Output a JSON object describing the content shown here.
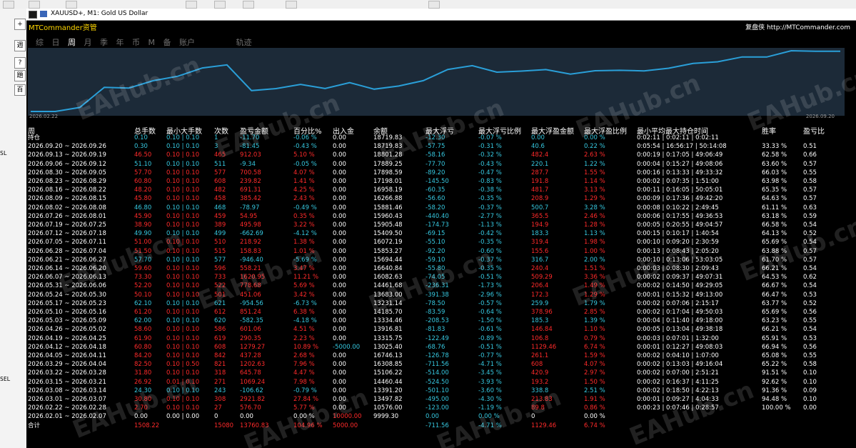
{
  "window": {
    "title": "XAUUSD+, M1:  Gold US Dollar"
  },
  "left_panel": {
    "buttons": [
      "+",
      "週",
      "?",
      "題",
      "百"
    ],
    "labels": [
      "SL",
      "SEL"
    ]
  },
  "header": {
    "brand": "MTCommander资管",
    "copyright": "复盘侠 http://MTCommander.com",
    "tabs": [
      "综",
      "日",
      "周",
      "月",
      "季",
      "年",
      "币",
      "M",
      "备",
      "账户"
    ],
    "active_tab": "周",
    "track_tab": "轨迹"
  },
  "plot": {
    "start_date": "2026.02.22",
    "end_date": "2026.09.20"
  },
  "watermark": "EAHub.cn",
  "colors": {
    "background": "#000000",
    "line": "#2a9fd8",
    "positive": "#ff2a2a",
    "negative": "#36c8e0",
    "neutral": "#ffffff"
  },
  "table": {
    "columns": [
      "周",
      "总手数",
      "最小大手数",
      "次数",
      "盈亏金额",
      "百分比%",
      "出入金",
      "余额",
      "最大浮亏",
      "最大浮亏比例",
      "最大浮盈金额",
      "最大浮盈比例",
      "最小平均最大持仓时间",
      "胜率",
      "盈亏比"
    ],
    "rows": [
      [
        "持仓",
        "0.10",
        "0.10 | 0.10",
        "1",
        "-11.70",
        "-0.06 %",
        "0.00",
        "18719.83",
        "-12.30",
        "-0.07 %",
        "0.00",
        "0.00 %",
        "0:02:11 | 0:02:11 | 0:02:11",
        "",
        ""
      ],
      [
        "2026.09.20 ~ 2026.09.26",
        "0.30",
        "0.10 | 0.10",
        "3",
        "-81.45",
        "-0.43 %",
        "0.00",
        "18719.83",
        "-57.75",
        "-0.31 %",
        "40.6",
        "0.22 %",
        "0:05:54 | 16:56:17 | 50:14:08",
        "33.33 %",
        "0.51"
      ],
      [
        "2026.09.13 ~ 2026.09.19",
        "46.50",
        "0.10 | 0.10",
        "465",
        "912.03",
        "5.10 %",
        "0.00",
        "18801.28",
        "-58.16",
        "-0.32 %",
        "482.4",
        "2.63 %",
        "0:00:19 | 0:17:05 | 49:06:49",
        "62.58 %",
        "0.66"
      ],
      [
        "2026.09.06 ~ 2026.09.12",
        "51.10",
        "0.10 | 0.10",
        "511",
        "-9.34",
        "-0.05 %",
        "0.00",
        "17889.25",
        "-77.70",
        "-0.43 %",
        "220.1",
        "1.22 %",
        "0:00:04 | 0:15:27 | 49:08:06",
        "63.60 %",
        "0.57"
      ],
      [
        "2026.08.30 ~ 2026.09.05",
        "57.70",
        "0.10 | 0.10",
        "577",
        "700.58",
        "4.07 %",
        "0.00",
        "17898.59",
        "-89.20",
        "-0.47 %",
        "287.7",
        "1.55 %",
        "0:00:16 | 0:13:33 | 49:33:32",
        "66.03 %",
        "0.55"
      ],
      [
        "2026.08.23 ~ 2026.08.29",
        "60.80",
        "0.10 | 0.10",
        "608",
        "239.82",
        "1.41 %",
        "0.00",
        "17198.01",
        "-145.50",
        "-0.83 %",
        "191.8",
        "1.14 %",
        "0:00:02 | 0:07:35 | 1:51:00",
        "63.98 %",
        "0.58"
      ],
      [
        "2026.08.16 ~ 2026.08.22",
        "48.20",
        "0.10 | 0.10",
        "482",
        "691.31",
        "4.25 %",
        "0.00",
        "16958.19",
        "-60.35",
        "-0.38 %",
        "481.7",
        "3.13 %",
        "0:00:11 | 0:16:05 | 50:05:01",
        "65.35 %",
        "0.57"
      ],
      [
        "2026.08.09 ~ 2026.08.15",
        "45.80",
        "0.10 | 0.10",
        "458",
        "385.42",
        "2.43 %",
        "0.00",
        "16266.88",
        "-56.60",
        "-0.35 %",
        "208.9",
        "1.29 %",
        "0:00:09 | 0:17:36 | 49:42:20",
        "64.63 %",
        "0.57"
      ],
      [
        "2026.08.02 ~ 2026.08.08",
        "46.80",
        "0.10 | 0.10",
        "468",
        "-78.97",
        "-0.49 %",
        "0.00",
        "15881.46",
        "-58.20",
        "-0.37 %",
        "500.7",
        "3.28 %",
        "0:00:08 | 0:10:22 | 2:49:45",
        "61.11 %",
        "0.63"
      ],
      [
        "2026.07.26 ~ 2026.08.01",
        "45.90",
        "0.10 | 0.10",
        "459",
        "54.95",
        "0.35 %",
        "0.00",
        "15960.43",
        "-440.40",
        "-2.77 %",
        "365.5",
        "2.46 %",
        "0:00:06 | 0:17:55 | 49:36:53",
        "63.18 %",
        "0.59"
      ],
      [
        "2026.07.19 ~ 2026.07.25",
        "38.90",
        "0.10 | 0.10",
        "389",
        "495.98",
        "3.22 %",
        "0.00",
        "15905.48",
        "-174.73",
        "-1.13 %",
        "194.9",
        "1.28 %",
        "0:00:05 | 0:20:55 | 49:04:57",
        "66.58 %",
        "0.54"
      ],
      [
        "2026.07.12 ~ 2026.07.18",
        "49.90",
        "0.10 | 0.10",
        "499",
        "-662.69",
        "-4.12 %",
        "0.00",
        "15409.50",
        "-69.15",
        "-0.42 %",
        "183.3",
        "1.13 %",
        "0:00:15 | 0:10:17 | 1:40:54",
        "64.13 %",
        "0.52"
      ],
      [
        "2026.07.05 ~ 2026.07.11",
        "51.00",
        "0.10 | 0.10",
        "510",
        "218.92",
        "1.38 %",
        "0.00",
        "16072.19",
        "-55.10",
        "-0.35 %",
        "319.4",
        "1.98 %",
        "0:00:10 | 0:09:20 | 2:30:59",
        "65.69 %",
        "0.54"
      ],
      [
        "2026.06.28 ~ 2026.07.04",
        "51.50",
        "0.10 | 0.10",
        "515",
        "158.83",
        "1.01 %",
        "0.00",
        "15853.27",
        "-92.20",
        "-0.60 %",
        "155.6",
        "1.00 %",
        "0:00:13 | 0:08:43 | 2:05:20",
        "63.88 %",
        "0.57"
      ],
      [
        "2026.06.21 ~ 2026.06.27",
        "57.70",
        "0.10 | 0.10",
        "577",
        "-946.40",
        "-5.69 %",
        "0.00",
        "15694.44",
        "-59.10",
        "-0.37 %",
        "316.7",
        "2.00 %",
        "0:00:10 | 0:13:06 | 53:03:05",
        "61.70 %",
        "0.57"
      ],
      [
        "2026.06.14 ~ 2026.06.20",
        "59.60",
        "0.10 | 0.10",
        "596",
        "558.21",
        "3.47 %",
        "0.00",
        "16640.84",
        "-55.80",
        "-0.35 %",
        "240.4",
        "1.51 %",
        "0:00:03 | 0:08:30 | 2:09:43",
        "66.21 %",
        "0.54"
      ],
      [
        "2026.06.07 ~ 2026.06.13",
        "73.30",
        "0.10 | 0.10",
        "733",
        "1620.95",
        "11.21 %",
        "0.00",
        "16082.63",
        "-74.05",
        "-0.51 %",
        "509.29",
        "3.36 %",
        "0:00:02 | 0:09:37 | 49:07:31",
        "64.53 %",
        "0.62"
      ],
      [
        "2026.05.31 ~ 2026.06.06",
        "52.20",
        "0.10 | 0.10",
        "522",
        "778.68",
        "5.69 %",
        "0.00",
        "14461.68",
        "-236.31",
        "-1.73 %",
        "206.4",
        "1.49 %",
        "0:00:02 | 0:14:50 | 49:29:05",
        "66.67 %",
        "0.54"
      ],
      [
        "2026.05.24 ~ 2026.05.30",
        "50.10",
        "0.10 | 0.10",
        "501",
        "451.06",
        "3.42 %",
        "0.00",
        "13683.00",
        "-391.38",
        "-2.96 %",
        "172.3",
        "1.29 %",
        "0:00:01 | 0:15:32 | 49:13:00",
        "66.47 %",
        "0.53"
      ],
      [
        "2026.05.17 ~ 2026.05.23",
        "62.10",
        "0.10 | 0.10",
        "621",
        "-954.56",
        "-6.73 %",
        "0.00",
        "13231.14",
        "-78.50",
        "-0.57 %",
        "259.9",
        "1.79 %",
        "0:00:02 | 0:07:06 | 2:15:17",
        "63.77 %",
        "0.52"
      ],
      [
        "2026.05.10 ~ 2026.05.16",
        "61.20",
        "0.10 | 0.10",
        "612",
        "851.24",
        "6.38 %",
        "0.00",
        "14185.70",
        "-83.59",
        "-0.64 %",
        "378.96",
        "2.85 %",
        "0:00:02 | 0:17:04 | 49:50:03",
        "65.69 %",
        "0.56"
      ],
      [
        "2026.05.03 ~ 2026.05.09",
        "62.00",
        "0.10 | 0.10",
        "620",
        "-582.35",
        "-4.18 %",
        "0.00",
        "13334.46",
        "-208.53",
        "-1.50 %",
        "185.3",
        "1.39 %",
        "0:00:04 | 0:11:40 | 49:18:00",
        "63.23 %",
        "0.55"
      ],
      [
        "2026.04.26 ~ 2026.05.02",
        "58.60",
        "0.10 | 0.10",
        "586",
        "601.06",
        "4.51 %",
        "0.00",
        "13916.81",
        "-81.83",
        "-0.61 %",
        "146.84",
        "1.10 %",
        "0:00:05 | 0:13:04 | 49:38:18",
        "66.21 %",
        "0.54"
      ],
      [
        "2026.04.19 ~ 2026.04.25",
        "61.90",
        "0.10 | 0.10",
        "619",
        "290.35",
        "2.23 %",
        "0.00",
        "13315.75",
        "-122.49",
        "-0.89 %",
        "106.8",
        "0.79 %",
        "0:00:03 | 0:07:01 | 1:32:00",
        "65.91 %",
        "0.53"
      ],
      [
        "2026.04.12 ~ 2026.04.18",
        "60.80",
        "0.10 | 0.10",
        "608",
        "1279.27",
        "10.89 %",
        "-5000.00",
        "13025.40",
        "-68.76",
        "-0.51 %",
        "1129.46",
        "6.74 %",
        "0:00:01 | 0:12:27 | 49:08:03",
        "66.94 %",
        "0.56"
      ],
      [
        "2026.04.05 ~ 2026.04.11",
        "84.20",
        "0.10 | 0.10",
        "842",
        "437.28",
        "2.68 %",
        "0.00",
        "16746.13",
        "-126.78",
        "-0.77 %",
        "261.1",
        "1.59 %",
        "0:00:02 | 0:04:10 | 1:07:00",
        "65.08 %",
        "0.55"
      ],
      [
        "2026.03.29 ~ 2026.04.04",
        "82.50",
        "0.10 | 0.50",
        "821",
        "1202.63",
        "7.96 %",
        "0.00",
        "16308.85",
        "-711.56",
        "-4.71 %",
        "608",
        "4.07 %",
        "0:00:02 | 0:13:03 | 49:16:04",
        "65.22 %",
        "0.58"
      ],
      [
        "2026.03.22 ~ 2026.03.28",
        "31.80",
        "0.10 | 0.10",
        "318",
        "645.78",
        "4.47 %",
        "0.00",
        "15106.22",
        "-514.00",
        "-3.45 %",
        "420.9",
        "2.97 %",
        "0:00:02 | 0:07:00 | 2:51:21",
        "91.51 %",
        "0.10"
      ],
      [
        "2026.03.15 ~ 2026.03.21",
        "26.92",
        "0.01 | 0.10",
        "271",
        "1069.24",
        "7.98 %",
        "0.00",
        "14460.44",
        "-524.50",
        "-3.93 %",
        "193.2",
        "1.50 %",
        "0:00:02 | 0:16:37 | 4:11:25",
        "92.62 %",
        "0.10"
      ],
      [
        "2026.03.08 ~ 2026.03.14",
        "24.30",
        "0.10 | 0.10",
        "243",
        "-106.62",
        "-0.79 %",
        "0.00",
        "13391.20",
        "-501.10",
        "-3.60 %",
        "338.8",
        "2.51 %",
        "0:00:02 | 0:18:50 | 4:22:13",
        "91.36 %",
        "0.09"
      ],
      [
        "2026.03.01 ~ 2026.03.07",
        "30.80",
        "0.10 | 0.10",
        "308",
        "2921.82",
        "27.84 %",
        "0.00",
        "13497.82",
        "-495.00",
        "-4.30 %",
        "213.83",
        "1.91 %",
        "0:00:01 | 0:09:27 | 4:04:33",
        "94.48 %",
        "0.10"
      ],
      [
        "2026.02.22 ~ 2026.02.28",
        "2.70",
        "0.10 | 0.10",
        "27",
        "576.70",
        "5.77 %",
        "0.00",
        "10576.00",
        "-123.00",
        "-1.19 %",
        "89.8",
        "0.86 %",
        "0:00:23 | 0:07:46 | 0:28:57",
        "100.00 %",
        "0.00"
      ],
      [
        "2026.02.01 ~ 2026.02.07",
        "0.00",
        "0.00 | 0.00",
        "0",
        "0.00",
        "0.00 %",
        "10000.00",
        "9999.30",
        "0.00",
        "0.00 %",
        "0",
        "0.00 %",
        "",
        "",
        ""
      ],
      [
        "合计",
        "1508.22",
        "",
        "15080",
        "13760.83",
        "104.96 %",
        "5000.00",
        "",
        "-711.56",
        "-4.71 %",
        "1129.46",
        "6.74 %",
        "",
        "",
        ""
      ]
    ]
  },
  "chart_data": {
    "type": "line",
    "series": [
      {
        "values": [
          9999,
          10000,
          10576,
          13498,
          13391,
          14460,
          15106,
          16309,
          16746,
          13025,
          13316,
          13917,
          13334,
          14186,
          13231,
          13683,
          14462,
          16083,
          16641,
          15694,
          15853,
          16072,
          15410,
          15905,
          15960,
          15881,
          16267,
          16958,
          17198,
          17899,
          17889,
          18801,
          18720,
          18720
        ]
      }
    ]
  }
}
